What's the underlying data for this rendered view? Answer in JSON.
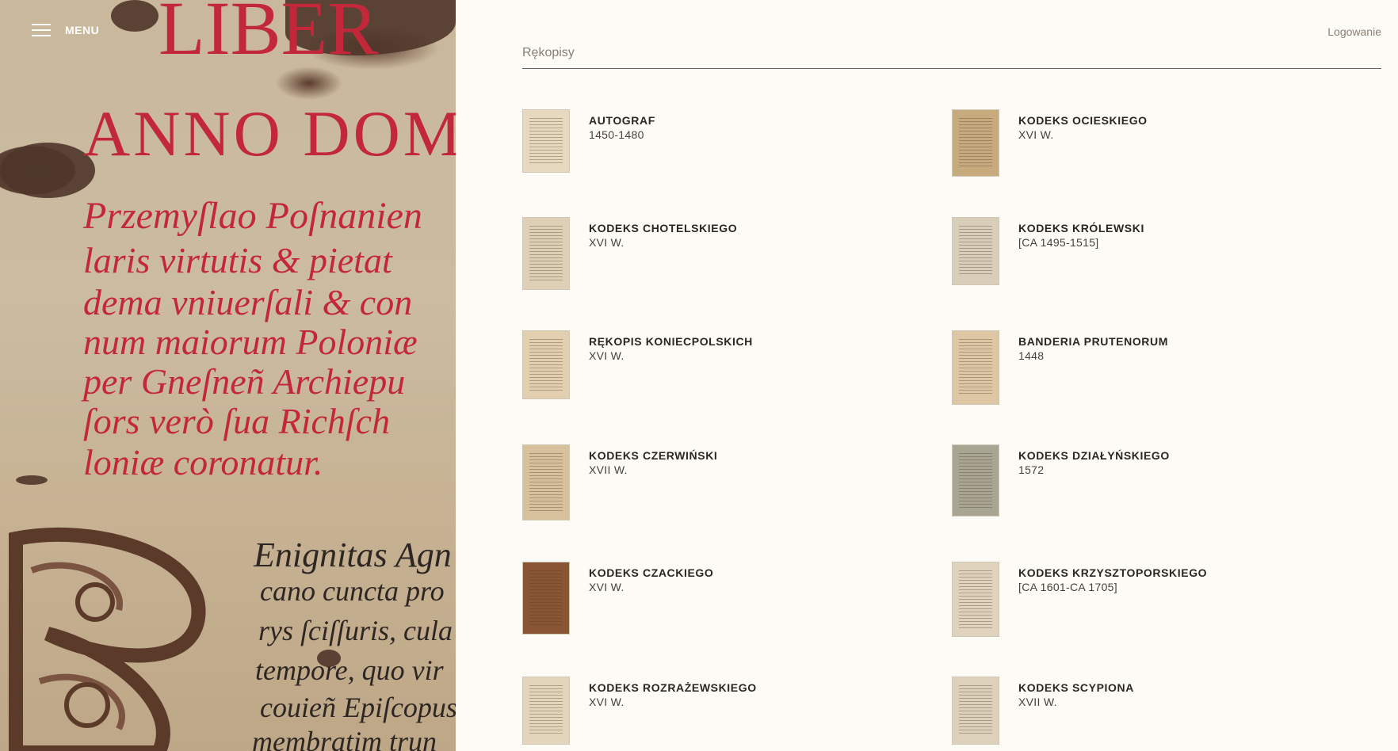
{
  "nav": {
    "menu_label": "MENU",
    "login_label": "Logowanie"
  },
  "hero": {
    "lines_red": [
      "LIBER",
      "ANNO DOM",
      "Przemyſlao Poſnanien",
      "laris virtutis & pietat",
      "dema vniuerſali & con",
      "num maiorum Poloniæ",
      "per Gneſneñ Archiepu",
      "ſors verò ſua Richſch",
      "loniæ coronatur."
    ],
    "lines_dark": [
      "Enignitas Agn",
      "cano cuncta pro",
      "rys ſciſſuris, cula",
      "tempore, quo vir",
      "couieñ Epiſcopus",
      "membratim trun"
    ]
  },
  "section": {
    "title": "Rękopisy"
  },
  "items": [
    {
      "name": "AUTOGRAF",
      "date": "1450-1480",
      "thumb_color": "#e6d9c0"
    },
    {
      "name": "KODEKS OCIESKIEGO",
      "date": "XVI W.",
      "thumb_color": "#c7ab7e"
    },
    {
      "name": "KODEKS CHOTELSKIEGO",
      "date": "XVI W.",
      "thumb_color": "#ddd0b7"
    },
    {
      "name": "KODEKS KRÓLEWSKI",
      "date": "[CA 1495-1515]",
      "thumb_color": "#d8ceb9"
    },
    {
      "name": "RĘKOPIS KONIECPOLSKICH",
      "date": "XVI W.",
      "thumb_color": "#e2cfb0"
    },
    {
      "name": "BANDERIA PRUTENORUM",
      "date": "1448",
      "thumb_color": "#ddc6a4"
    },
    {
      "name": "KODEKS CZERWIŃSKI",
      "date": "XVII W.",
      "thumb_color": "#d7c09c"
    },
    {
      "name": "KODEKS DZIAŁYŃSKIEGO",
      "date": "1572",
      "thumb_color": "#a9a593"
    },
    {
      "name": "KODEKS CZACKIEGO",
      "date": "XVI W.",
      "thumb_color": "#8a5535"
    },
    {
      "name": "KODEKS KRZYSZTOPORSKIEGO",
      "date": "[CA 1601-CA 1705]",
      "thumb_color": "#e0d3bd"
    },
    {
      "name": "KODEKS ROZRAŻEWSKIEGO",
      "date": "XVI W.",
      "thumb_color": "#e2d5bc"
    },
    {
      "name": "KODEKS SCYPIONA",
      "date": "XVII W.",
      "thumb_color": "#ddd1bb"
    }
  ]
}
